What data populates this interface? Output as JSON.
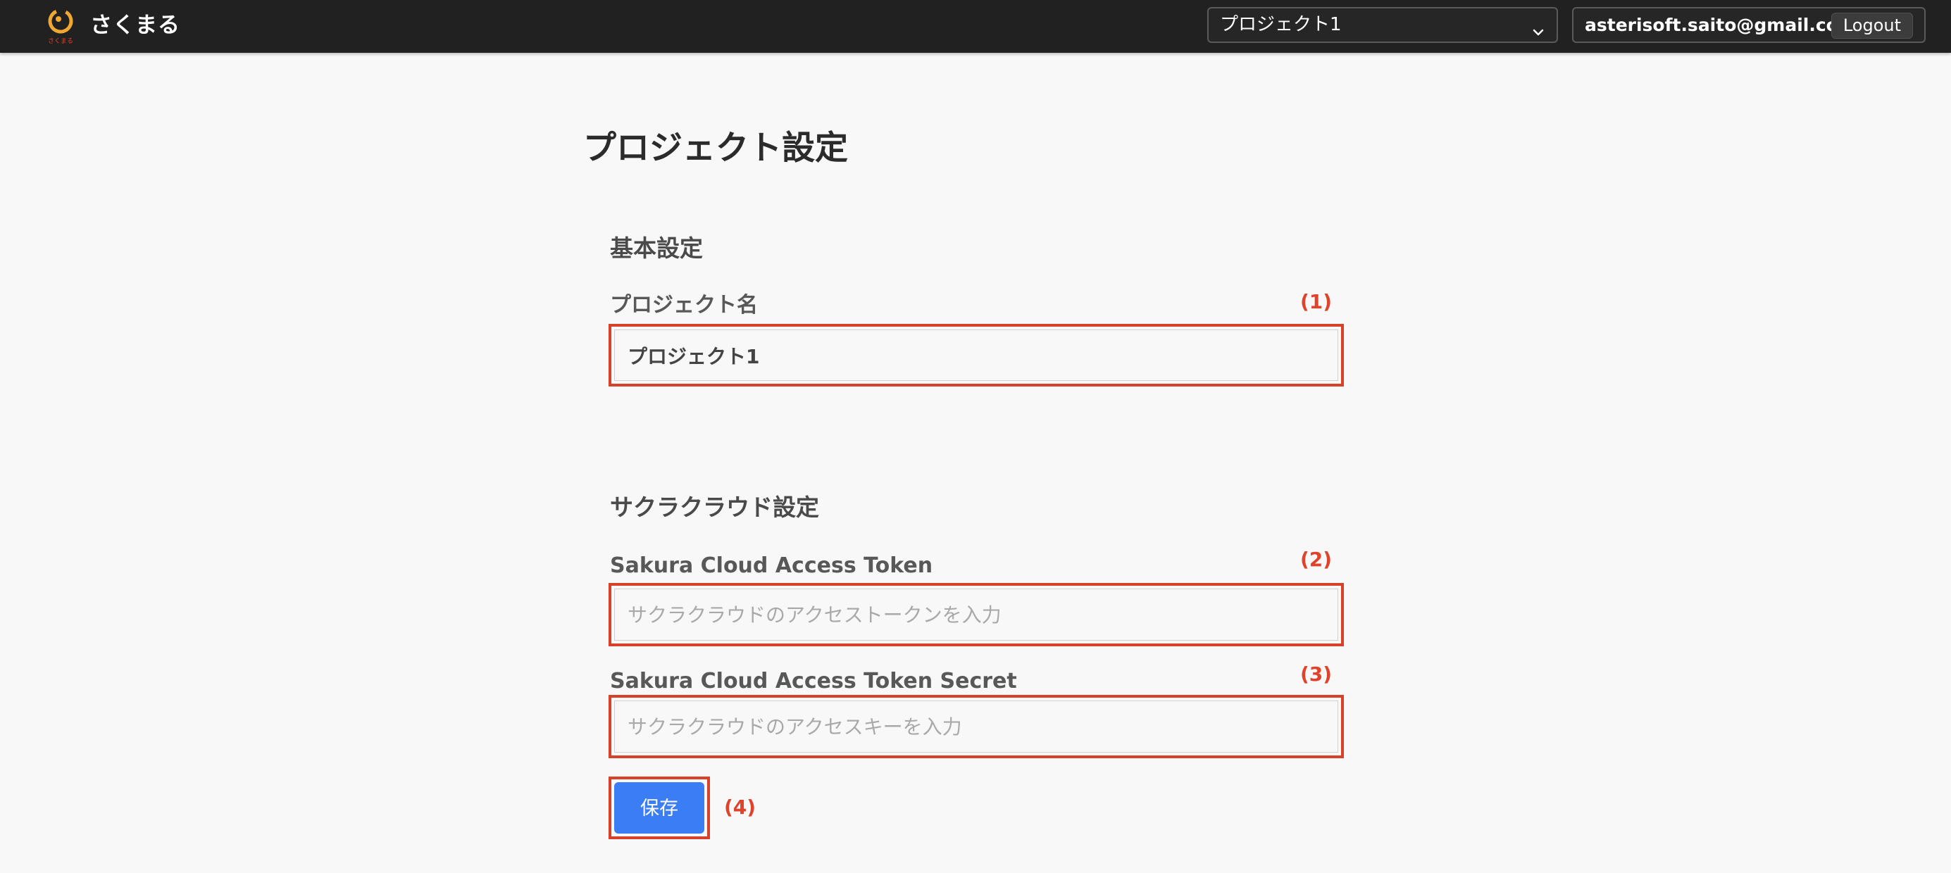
{
  "header": {
    "app_name": "さくまる",
    "logo_caption": "さくまる",
    "project_select": {
      "value": "プロジェクト1"
    },
    "user_email": "asterisoft.saito@gmail.com",
    "logout_label": "Logout"
  },
  "page": {
    "title": "プロジェクト設定"
  },
  "basic": {
    "section_title": "基本設定",
    "project_name_label": "プロジェクト名",
    "project_name_value": "プロジェクト1",
    "callout": "(1)"
  },
  "sakura": {
    "section_title": "サクラクラウド設定",
    "token_label": "Sakura Cloud Access Token",
    "token_placeholder": "サクラクラウドのアクセストークンを入力",
    "token_callout": "(2)",
    "secret_label": "Sakura Cloud Access Token Secret",
    "secret_placeholder": "サクラクラウドのアクセスキーを入力",
    "secret_callout": "(3)"
  },
  "actions": {
    "save_label": "保存",
    "save_callout": "(4)"
  },
  "colors": {
    "topbar": "#212121",
    "logo": "#f0a830",
    "accent_red": "#d9402a",
    "save_button": "#3b7df5"
  }
}
